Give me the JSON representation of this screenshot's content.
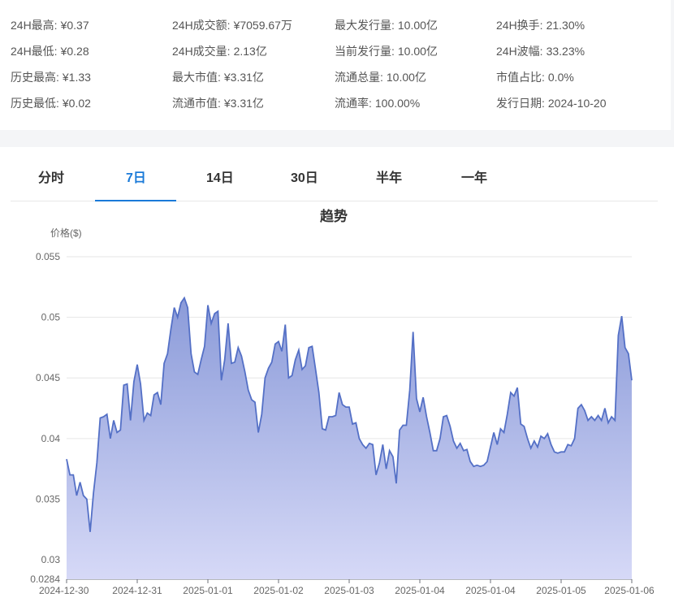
{
  "stats": [
    {
      "key": "24H最高:",
      "value": "¥0.37"
    },
    {
      "key": "24H成交额:",
      "value": "¥7059.67万"
    },
    {
      "key": "最大发行量:",
      "value": "10.00亿"
    },
    {
      "key": "24H换手:",
      "value": "21.30%"
    },
    {
      "key": "24H最低:",
      "value": "¥0.28"
    },
    {
      "key": "24H成交量:",
      "value": "2.13亿"
    },
    {
      "key": "当前发行量:",
      "value": "10.00亿"
    },
    {
      "key": "24H波幅:",
      "value": "33.23%"
    },
    {
      "key": "历史最高:",
      "value": "¥1.33"
    },
    {
      "key": "最大市值:",
      "value": "¥3.31亿"
    },
    {
      "key": "流通总量:",
      "value": "10.00亿"
    },
    {
      "key": "市值占比:",
      "value": "0.0%"
    },
    {
      "key": "历史最低:",
      "value": "¥0.02"
    },
    {
      "key": "流通市值:",
      "value": "¥3.31亿"
    },
    {
      "key": "流通率:",
      "value": "100.00%"
    },
    {
      "key": "发行日期:",
      "value": "2024-10-20"
    }
  ],
  "tabs": [
    {
      "label": "分时",
      "active": false
    },
    {
      "label": "7日",
      "active": true
    },
    {
      "label": "14日",
      "active": false
    },
    {
      "label": "30日",
      "active": false
    },
    {
      "label": "半年",
      "active": false
    },
    {
      "label": "一年",
      "active": false
    }
  ],
  "colors": {
    "accent": "#1a7ad8",
    "line": "#5470c6",
    "fill_top": "#8b9bd9",
    "fill_bottom": "#d6d9f7"
  },
  "chart_data": {
    "type": "area",
    "title": "趋势",
    "ylabel": "价格($)",
    "ylim": [
      0.0284,
      0.055
    ],
    "y_ticks": [
      "0.055",
      "0.05",
      "0.045",
      "0.04",
      "0.035",
      "0.03",
      "0.0284"
    ],
    "x_ticks": [
      "2024-12-30",
      "2024-12-31",
      "2025-01-01",
      "2025-01-02",
      "2025-01-03",
      "2025-01-04",
      "2025-01-04",
      "2025-01-05",
      "2025-01-06"
    ],
    "grid": true,
    "series": [
      {
        "values": [
          0.0383,
          0.037,
          0.037,
          0.0353,
          0.0364,
          0.0353,
          0.035,
          0.0323,
          0.0355,
          0.038,
          0.0417,
          0.0418,
          0.042,
          0.04,
          0.0415,
          0.0405,
          0.0407,
          0.0444,
          0.0445,
          0.0415,
          0.0447,
          0.0461,
          0.0445,
          0.0415,
          0.0421,
          0.0419,
          0.0436,
          0.0438,
          0.0428,
          0.0462,
          0.047,
          0.049,
          0.0508,
          0.05,
          0.0512,
          0.0516,
          0.0508,
          0.047,
          0.0455,
          0.0453,
          0.0465,
          0.0476,
          0.051,
          0.0495,
          0.0503,
          0.0505,
          0.0448,
          0.0465,
          0.0495,
          0.0462,
          0.0463,
          0.0475,
          0.0468,
          0.0455,
          0.044,
          0.0432,
          0.043,
          0.0405,
          0.042,
          0.045,
          0.0458,
          0.0463,
          0.0478,
          0.048,
          0.0472,
          0.0494,
          0.045,
          0.0452,
          0.0465,
          0.0473,
          0.0457,
          0.046,
          0.0475,
          0.0476,
          0.0457,
          0.0438,
          0.0408,
          0.0407,
          0.0418,
          0.0418,
          0.0419,
          0.0438,
          0.0428,
          0.0426,
          0.0426,
          0.0412,
          0.0413,
          0.04,
          0.0395,
          0.0392,
          0.0396,
          0.0395,
          0.037,
          0.038,
          0.0395,
          0.0375,
          0.039,
          0.0385,
          0.0363,
          0.0407,
          0.0411,
          0.0411,
          0.044,
          0.0488,
          0.0433,
          0.0422,
          0.0434,
          0.0418,
          0.0405,
          0.039,
          0.039,
          0.04,
          0.0418,
          0.0419,
          0.041,
          0.0398,
          0.0392,
          0.0396,
          0.039,
          0.0391,
          0.0381,
          0.0377,
          0.0378,
          0.0377,
          0.0378,
          0.0381,
          0.0393,
          0.0405,
          0.0395,
          0.0408,
          0.0405,
          0.042,
          0.0438,
          0.0435,
          0.0442,
          0.0412,
          0.041,
          0.04,
          0.0392,
          0.0398,
          0.0393,
          0.0402,
          0.04,
          0.0404,
          0.0395,
          0.0389,
          0.0388,
          0.0389,
          0.0389,
          0.0395,
          0.0394,
          0.04,
          0.0425,
          0.0428,
          0.0423,
          0.0415,
          0.0418,
          0.0415,
          0.0419,
          0.0415,
          0.0425,
          0.0413,
          0.0418,
          0.0415,
          0.0485,
          0.0501,
          0.0475,
          0.047,
          0.0448
        ]
      }
    ]
  }
}
